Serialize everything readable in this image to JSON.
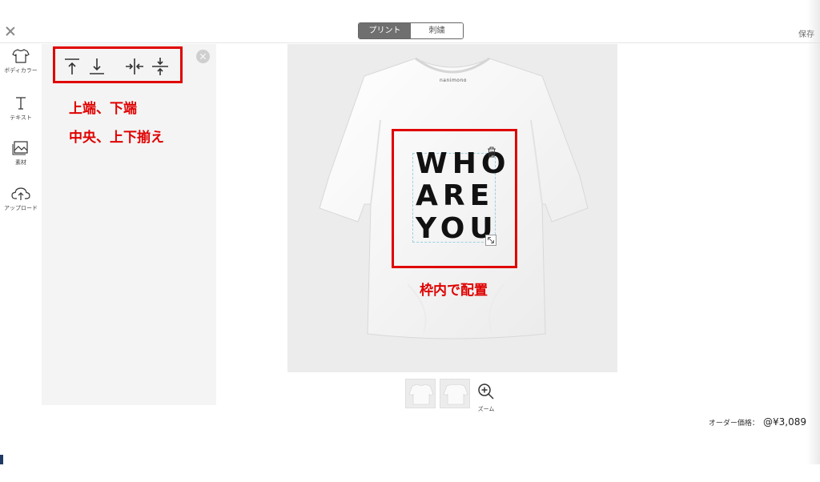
{
  "header": {
    "tabs": [
      {
        "label": "プリント",
        "active": true
      },
      {
        "label": "刺繍",
        "active": false
      }
    ],
    "save_label": "保存"
  },
  "sidebar": {
    "items": [
      {
        "label": "ボディカラー",
        "icon": "tshirt-icon"
      },
      {
        "label": "テキスト",
        "icon": "text-t-icon"
      },
      {
        "label": "素材",
        "icon": "image-icon"
      },
      {
        "label": "アップロード",
        "icon": "cloud-upload-icon"
      }
    ]
  },
  "panel": {
    "align_buttons": [
      {
        "icon": "align-top-icon"
      },
      {
        "icon": "align-bottom-icon"
      },
      {
        "icon": "align-center-horizontal-icon"
      },
      {
        "icon": "align-center-vertical-icon"
      }
    ]
  },
  "annotations": {
    "line1": "上端、下端",
    "line2": "中央、上下揃え",
    "print_area": "枠内で配置"
  },
  "canvas": {
    "brand": "nanimono",
    "design_lines": [
      "WHO",
      "ARE",
      "YOU"
    ]
  },
  "thumbnails": {
    "zoom_label": "ズーム"
  },
  "order": {
    "price_label": "オーダー価格：",
    "price_value": "@¥3,089"
  },
  "colors": {
    "annotation_red": "#e00000",
    "active_tab": "#6f6f6f",
    "panel_bg": "#f4f4f4",
    "canvas_bg": "#ececec"
  }
}
